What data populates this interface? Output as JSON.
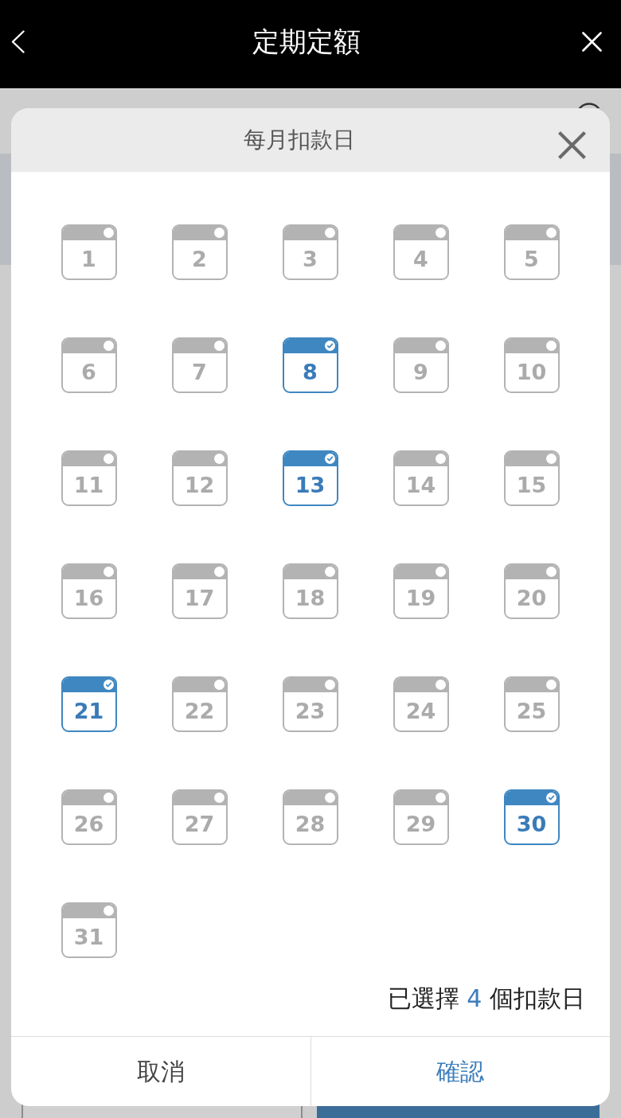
{
  "top_bar": {
    "title": "定期定額"
  },
  "modal": {
    "title": "每月扣款日",
    "days": [
      {
        "label": "1",
        "selected": false
      },
      {
        "label": "2",
        "selected": false
      },
      {
        "label": "3",
        "selected": false
      },
      {
        "label": "4",
        "selected": false
      },
      {
        "label": "5",
        "selected": false
      },
      {
        "label": "6",
        "selected": false
      },
      {
        "label": "7",
        "selected": false
      },
      {
        "label": "8",
        "selected": true
      },
      {
        "label": "9",
        "selected": false
      },
      {
        "label": "10",
        "selected": false
      },
      {
        "label": "11",
        "selected": false
      },
      {
        "label": "12",
        "selected": false
      },
      {
        "label": "13",
        "selected": true
      },
      {
        "label": "14",
        "selected": false
      },
      {
        "label": "15",
        "selected": false
      },
      {
        "label": "16",
        "selected": false
      },
      {
        "label": "17",
        "selected": false
      },
      {
        "label": "18",
        "selected": false
      },
      {
        "label": "19",
        "selected": false
      },
      {
        "label": "20",
        "selected": false
      },
      {
        "label": "21",
        "selected": true
      },
      {
        "label": "22",
        "selected": false
      },
      {
        "label": "23",
        "selected": false
      },
      {
        "label": "24",
        "selected": false
      },
      {
        "label": "25",
        "selected": false
      },
      {
        "label": "26",
        "selected": false
      },
      {
        "label": "27",
        "selected": false
      },
      {
        "label": "28",
        "selected": false
      },
      {
        "label": "29",
        "selected": false
      },
      {
        "label": "30",
        "selected": true
      },
      {
        "label": "31",
        "selected": false
      }
    ],
    "summary": {
      "text_before": "已選擇 ",
      "count": "4",
      "text_after": " 個扣款日"
    },
    "buttons": [
      {
        "label": "取消",
        "kind": "cancel"
      },
      {
        "label": "確認",
        "kind": "confirm"
      }
    ]
  }
}
